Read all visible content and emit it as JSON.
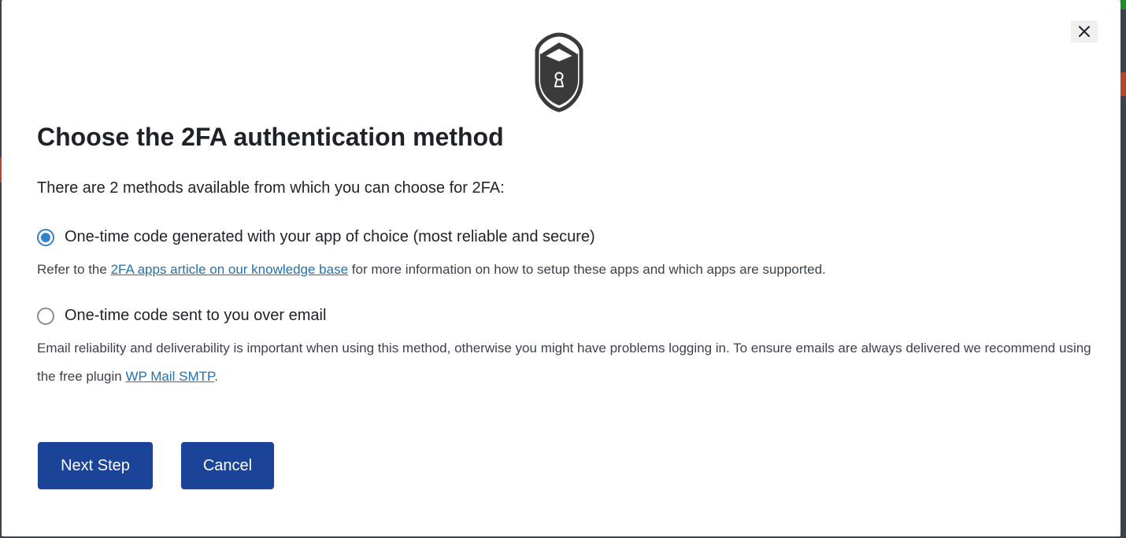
{
  "modal": {
    "title": "Choose the 2FA authentication method",
    "intro": "There are 2 methods available from which you can choose for 2FA:",
    "close_icon": "close-icon",
    "header_icon": "shield-lock-icon",
    "accent_color": "#1b4398",
    "link_color": "#2271b1"
  },
  "options": [
    {
      "label": "One-time code generated with your app of choice (most reliable and secure)",
      "checked": true,
      "desc_before": "Refer to the ",
      "desc_link": "2FA apps article on our knowledge base",
      "desc_after": " for more information on how to setup these apps and which apps are supported."
    },
    {
      "label": "One-time code sent to you over email",
      "checked": false,
      "desc_before": "Email reliability and deliverability is important when using this method, otherwise you might have problems logging in. To ensure emails are always delivered we recommend using the free plugin ",
      "desc_link": "WP Mail SMTP",
      "desc_after": "."
    }
  ],
  "buttons": {
    "next": "Next Step",
    "cancel": "Cancel"
  }
}
